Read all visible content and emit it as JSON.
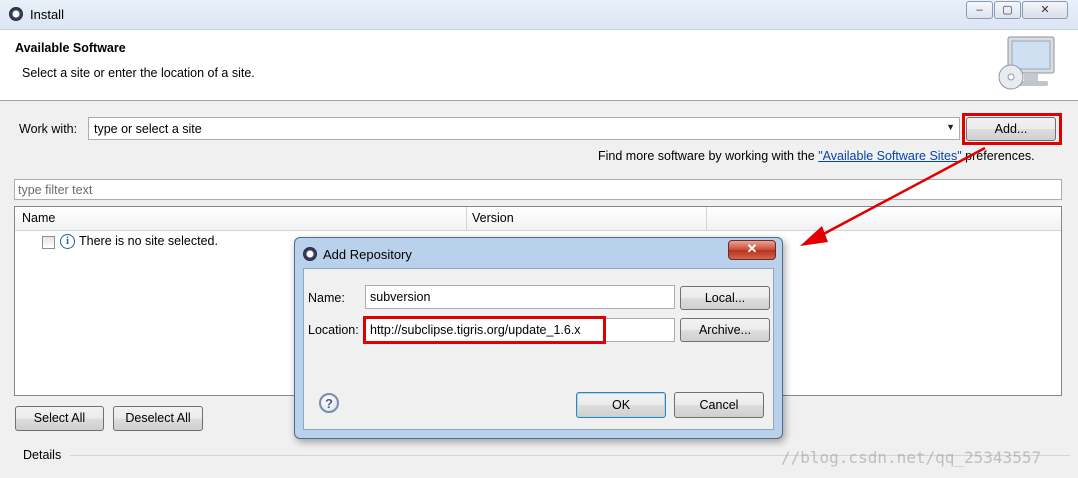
{
  "window": {
    "title": "Install"
  },
  "header": {
    "title": "Available Software",
    "subtitle": "Select a site or enter the location of a site."
  },
  "work_with": {
    "label": "Work with:",
    "value": "type or select a site",
    "add_button": "Add...",
    "more_prefix": "Find more software by working with the ",
    "more_link": "\"Available Software Sites\"",
    "more_suffix": " preferences."
  },
  "filter": {
    "placeholder": "type filter text"
  },
  "table": {
    "columns": [
      "Name",
      "Version"
    ],
    "empty_message": "There is no site selected."
  },
  "buttons": {
    "select_all": "Select All",
    "deselect_all": "Deselect All"
  },
  "details": {
    "label": "Details"
  },
  "dialog": {
    "title": "Add Repository",
    "name_label": "Name:",
    "name_value": "subversion",
    "location_label": "Location:",
    "location_value": "http://subclipse.tigris.org/update_1.6.x",
    "local_button": "Local...",
    "archive_button": "Archive...",
    "ok_button": "OK",
    "cancel_button": "Cancel"
  },
  "watermark": "//blog.csdn.net/qq_25343557",
  "colors": {
    "highlight": "#e00000",
    "link": "#0645ad",
    "dialog_frame": "#b9d1ea"
  }
}
